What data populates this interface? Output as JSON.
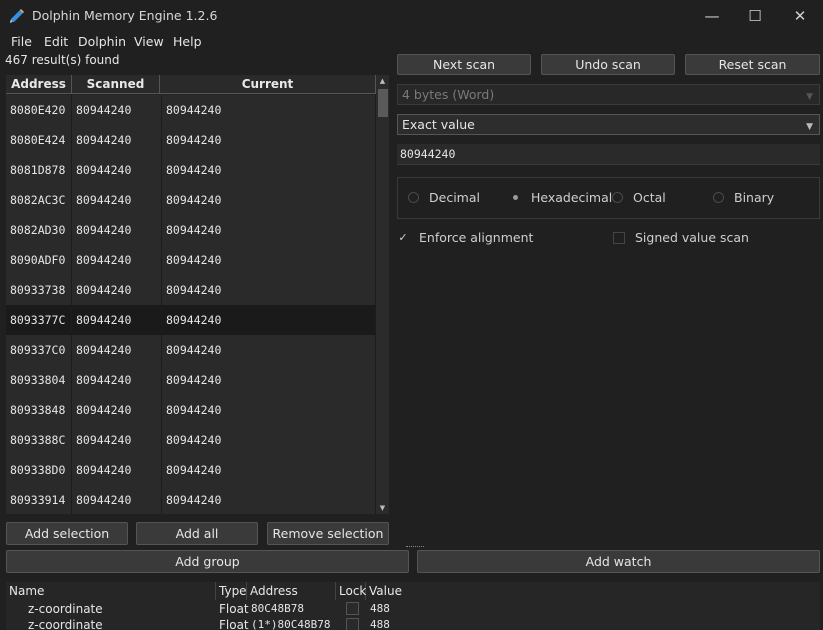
{
  "window": {
    "title": "Dolphin Memory Engine 1.2.6",
    "minimize_glyph": "—",
    "maximize_glyph": "☐",
    "close_glyph": "✕"
  },
  "menu": [
    "File",
    "Edit",
    "Dolphin",
    "View",
    "Help"
  ],
  "status": {
    "result_count": "467 result(s) found"
  },
  "results": {
    "headers": [
      "Address",
      "Scanned",
      "Current"
    ],
    "rows": [
      {
        "address": "8080E420",
        "scanned": "80944240",
        "current": "80944240"
      },
      {
        "address": "8080E424",
        "scanned": "80944240",
        "current": "80944240"
      },
      {
        "address": "8081D878",
        "scanned": "80944240",
        "current": "80944240"
      },
      {
        "address": "8082AC3C",
        "scanned": "80944240",
        "current": "80944240"
      },
      {
        "address": "8082AD30",
        "scanned": "80944240",
        "current": "80944240"
      },
      {
        "address": "8090ADF0",
        "scanned": "80944240",
        "current": "80944240"
      },
      {
        "address": "80933738",
        "scanned": "80944240",
        "current": "80944240"
      },
      {
        "address": "8093377C",
        "scanned": "80944240",
        "current": "80944240"
      },
      {
        "address": "809337C0",
        "scanned": "80944240",
        "current": "80944240"
      },
      {
        "address": "80933804",
        "scanned": "80944240",
        "current": "80944240"
      },
      {
        "address": "80933848",
        "scanned": "80944240",
        "current": "80944240"
      },
      {
        "address": "8093388C",
        "scanned": "80944240",
        "current": "80944240"
      },
      {
        "address": "809338D0",
        "scanned": "80944240",
        "current": "80944240"
      },
      {
        "address": "80933914",
        "scanned": "80944240",
        "current": "80944240"
      }
    ],
    "selected_index": 7
  },
  "scan_buttons": {
    "next": "Next scan",
    "undo": "Undo scan",
    "reset": "Reset scan"
  },
  "scan_options": {
    "type_value": "4 bytes (Word)",
    "filter_value": "Exact value",
    "search_value": "80944240",
    "bases": [
      "Decimal",
      "Hexadecimal",
      "Octal",
      "Binary"
    ],
    "selected_base": "Hexadecimal",
    "enforce_alignment": "Enforce alignment",
    "enforce_alignment_checked": true,
    "signed_scan": "Signed value scan",
    "signed_scan_checked": false
  },
  "result_buttons": {
    "add_selection": "Add selection",
    "add_all": "Add all",
    "remove_selection": "Remove selection"
  },
  "watch_buttons": {
    "add_group": "Add group",
    "add_watch": "Add watch"
  },
  "watch": {
    "headers": [
      "Name",
      "Type",
      "Address",
      "Lock",
      "Value"
    ],
    "rows": [
      {
        "name": "z-coordinate",
        "type": "Float",
        "address": "80C48B78",
        "locked": false,
        "value": "488"
      },
      {
        "name": "z-coordinate",
        "type": "Float",
        "address": "(1*)80C48B78",
        "locked": false,
        "value": "488"
      }
    ]
  },
  "colors": {
    "background": "#202020",
    "table_row": "#2a2a2a",
    "selected_row": "#1a1a1a",
    "button": "#3a3a3a"
  }
}
